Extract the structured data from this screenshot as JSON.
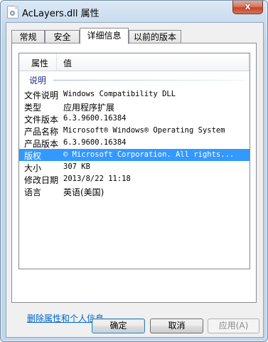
{
  "window": {
    "title": "AcLayers.dll 属性",
    "close_label": "x"
  },
  "tabs": [
    {
      "label": "常规"
    },
    {
      "label": "安全"
    },
    {
      "label": "详细信息"
    },
    {
      "label": "以前的版本"
    }
  ],
  "active_tab": 2,
  "list": {
    "columns": [
      "属性",
      "值"
    ],
    "group": "说明",
    "rows": [
      {
        "key": "文件说明",
        "value": "Windows Compatibility DLL"
      },
      {
        "key": "类型",
        "value": "应用程序扩展"
      },
      {
        "key": "文件版本",
        "value": "6.3.9600.16384"
      },
      {
        "key": "产品名称",
        "value": "Microsoft® Windows® Operating System"
      },
      {
        "key": "产品版本",
        "value": "6.3.9600.16384"
      },
      {
        "key": "版权",
        "value": "© Microsoft Corporation. All rights..."
      },
      {
        "key": "大小",
        "value": "307 KB"
      },
      {
        "key": "修改日期",
        "value": "2013/8/22 11:18"
      },
      {
        "key": "语言",
        "value": "英语(美国)"
      }
    ],
    "selected_index": 5
  },
  "remove_link": "删除属性和个人信息",
  "buttons": {
    "ok": "确定",
    "cancel": "取消",
    "apply": "应用(A)"
  }
}
